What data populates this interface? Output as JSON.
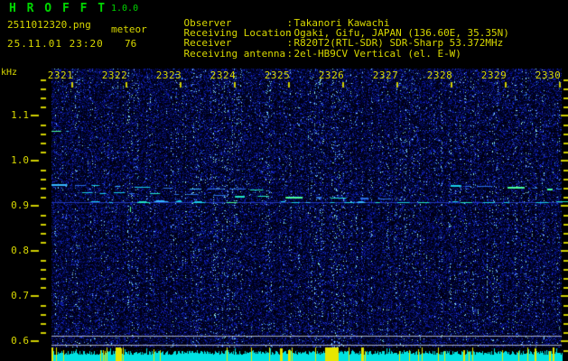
{
  "header": {
    "app_name": "H R O F F T",
    "version": "1.0.0",
    "filename": "2511012320.png",
    "mode": "meteor",
    "datetime": "25.11.01 23:20",
    "echo_count": "76",
    "separator": ":",
    "info": [
      {
        "label": "Observer",
        "value": "Takanori Kawachi"
      },
      {
        "label": "Receiving Location",
        "value": "Ogaki, Gifu, JAPAN (136.60E, 35.35N)"
      },
      {
        "label": "Receiver",
        "value": "R820T2(RTL-SDR) SDR-Sharp 53.372MHz"
      },
      {
        "label": "Receiving antenna",
        "value": "2el-HB9CV Vertical (el. E-W)"
      }
    ]
  },
  "chart_data": {
    "type": "heatmap",
    "title": "HROFFT 10-minute radio meteor echo spectrogram",
    "x_axis": {
      "unit": "time (hhmm)",
      "tick_labels": [
        "2321",
        "2322",
        "2323",
        "2324",
        "2325",
        "2326",
        "2327",
        "2328",
        "2329",
        "2330"
      ],
      "range": [
        "23:20",
        "23:30"
      ]
    },
    "y_axis": {
      "unit_label": "kHz",
      "tick_labels": [
        "1.1",
        "1.0",
        "0.9",
        "0.8",
        "0.7",
        "0.6"
      ],
      "range_khz": [
        0.585,
        1.2
      ],
      "minor_tick_khz": 0.02
    },
    "reference_lines_khz": [
      0.612,
      0.592
    ],
    "traces": [
      {
        "kind": "carrier-line",
        "style": "solid",
        "t_min": [
          0.63,
          10.05
        ],
        "khz": [
          0.908,
          0.908
        ],
        "bright_dashes": true
      },
      {
        "kind": "echo-trail",
        "style": "dashed",
        "t_min": [
          0.63,
          4.7
        ],
        "khz": [
          0.949,
          0.9335
        ]
      },
      {
        "kind": "echo-trail",
        "style": "dashed",
        "t_min": [
          1.2,
          6.9
        ],
        "khz": [
          0.9295,
          0.917
        ]
      },
      {
        "kind": "echo-trail",
        "style": "dashed",
        "t_min": [
          8.0,
          10.05
        ],
        "khz": [
          0.9455,
          0.9375
        ]
      },
      {
        "kind": "blip-vertical",
        "style": "solid",
        "t_min": [
          2.08,
          2.08
        ],
        "khz": [
          0.899,
          0.887
        ]
      },
      {
        "kind": "blip",
        "style": "dashed",
        "t_min": [
          0.63,
          0.95
        ],
        "khz": [
          1.066,
          1.066
        ]
      }
    ],
    "noise": {
      "seed": 20251101,
      "description": "uniform dark-blue background noise field"
    },
    "activity_strip": {
      "seed": 2320,
      "description": "bottom long-term signal-level strip: cyan level bar with yellow echo spikes",
      "wide_spike_t_min": [
        [
          1.82,
          1.92
        ],
        [
          5.68,
          5.93
        ]
      ],
      "spike_density": 0.11
    }
  },
  "colors": {
    "background": "#000000",
    "title_green": "#00d800",
    "text_yellow": "#d8d800",
    "tick_yellow": "#cfcf00",
    "reference_gray": "#aab2c2",
    "carrier_dim_blue": "#2038b8",
    "strip_cyan": "#00e2e2",
    "spike_yellow": "#e6e600",
    "trace_bright": [
      "#22e6c4",
      "#4aff9c",
      "#35b9ff",
      "#19cfe8"
    ]
  }
}
